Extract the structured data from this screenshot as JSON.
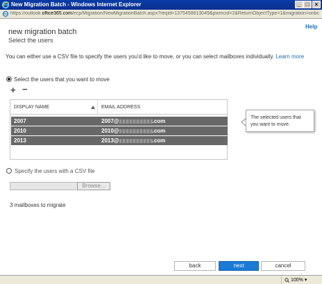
{
  "window": {
    "title": "New Migration Batch - Windows Internet Explorer",
    "min_label": "_",
    "max_label": "□",
    "close_label": "×"
  },
  "address": {
    "prefix": "https://outlook.",
    "host": "office365.com",
    "path": "/ecp/Migration/NewMigrationBatch.aspx?reqId=1375458613049&pwmcid=2&ReturnObjectType=1&migration=onbc"
  },
  "help_label": "Help",
  "page": {
    "title": "new migration batch",
    "subtitle": "Select the users"
  },
  "intro": {
    "text": "You can either use a CSV file to specify the users you'd like to move, or you can select mailboxes individually.",
    "learn_more": "Learn more"
  },
  "option_select": {
    "label": "Select the users that you want to move",
    "checked": true
  },
  "toolbar": {
    "add_label": "+",
    "remove_label": "−"
  },
  "grid": {
    "columns": [
      "DISPLAY NAME",
      "EMAIL ADDRESS"
    ],
    "rows": [
      {
        "name": "2007",
        "email_prefix": "2007@",
        "email_suffix": ".com"
      },
      {
        "name": "2010",
        "email_prefix": "2010@",
        "email_suffix": ".com"
      },
      {
        "name": "2013",
        "email_prefix": "2013@",
        "email_suffix": ".com"
      }
    ]
  },
  "tooltip": {
    "text": "The selected users that you want to move."
  },
  "option_csv": {
    "label": "Specify the users with a CSV file",
    "checked": false
  },
  "file": {
    "value": "",
    "browse_label": "Browse..."
  },
  "count_text": "3 mailboxes to migrate",
  "footer": {
    "back_label": "back",
    "next_label": "next",
    "cancel_label": "cancel"
  },
  "status": {
    "zoom": "100%"
  },
  "colors": {
    "accent": "#1a7ad6",
    "selected_row": "#686868",
    "link": "#1a6fb5"
  }
}
